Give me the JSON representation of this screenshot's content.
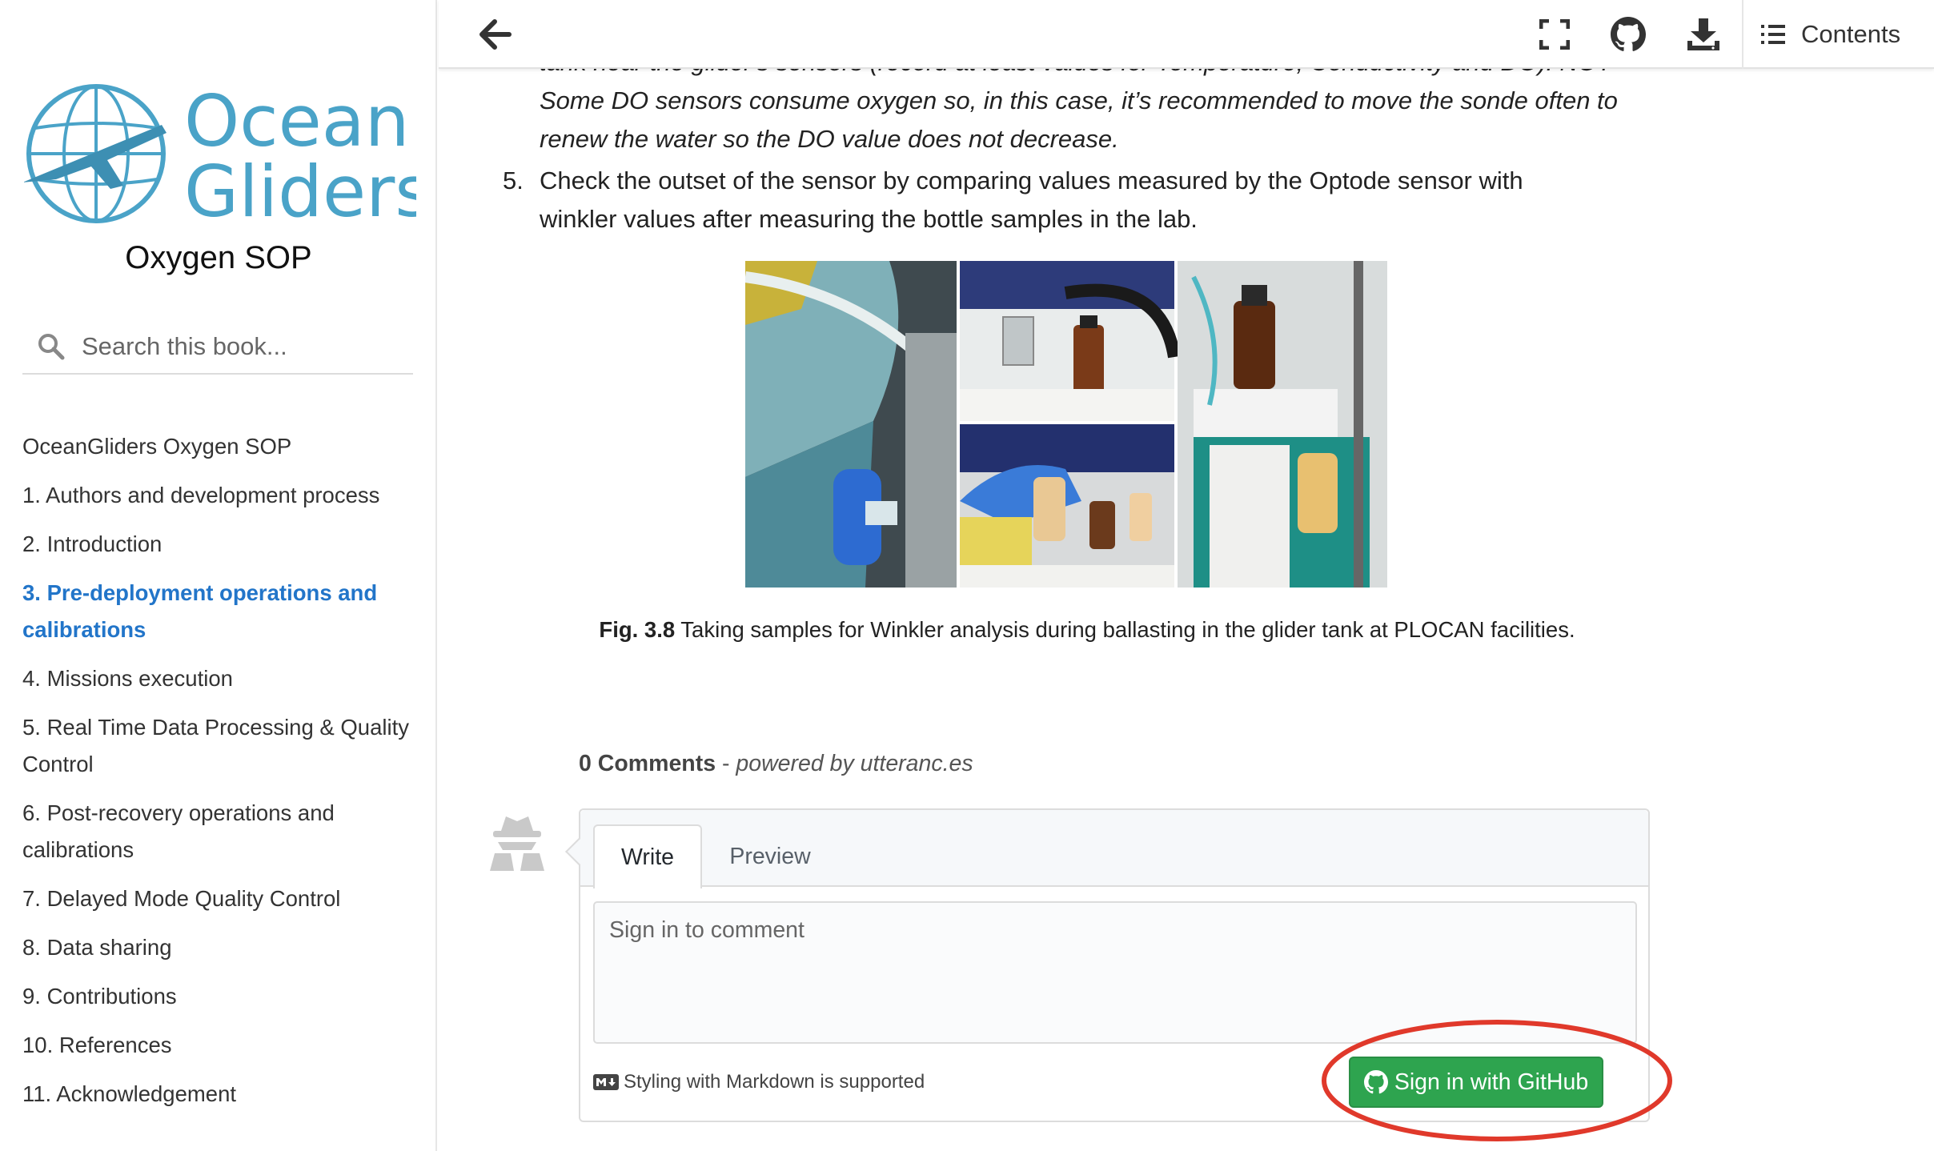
{
  "sidebar": {
    "logo_word1": "Ocean",
    "logo_word2": "Gliders",
    "book_title": "Oxygen SOP",
    "search_placeholder": "Search this book...",
    "toc": [
      {
        "label": "OceanGliders Oxygen SOP",
        "active": false
      },
      {
        "label": "1. Authors and development process",
        "active": false
      },
      {
        "label": "2. Introduction",
        "active": false
      },
      {
        "label": "3. Pre-deployment operations and calibrations",
        "active": true
      },
      {
        "label": "4. Missions execution",
        "active": false
      },
      {
        "label": "5. Real Time Data Processing & Quality Control",
        "active": false
      },
      {
        "label": "6. Post-recovery operations and calibrations",
        "active": false
      },
      {
        "label": "7. Delayed Mode Quality Control",
        "active": false
      },
      {
        "label": "8. Data sharing",
        "active": false
      },
      {
        "label": "9. Contributions",
        "active": false
      },
      {
        "label": "10. References",
        "active": false
      },
      {
        "label": "11. Acknowledgement",
        "active": false
      }
    ]
  },
  "topbar": {
    "back_icon": "arrow-left-icon",
    "fullscreen_icon": "fullscreen-icon",
    "github_icon": "github-icon",
    "download_icon": "download-icon",
    "contents_label": "Contents"
  },
  "article": {
    "cut_line": "tank near the glider's sensors (record at least values for Temperature, Conductivity and DO). NOTE:",
    "note_line1": "Some DO sensors consume oxygen so, in this case, it’s recommended to move the sonde often to",
    "note_line2": "renew the water so the DO value does not decrease.",
    "item5_number": "5.",
    "item5_text": "Check the outset of the sensor by comparing values measured by the Optode sensor with winkler values after measuring the bottle samples in the lab.",
    "figure_label": "Fig. 3.8",
    "figure_caption": " Taking samples for Winkler analysis during ballasting in the glider tank at PLOCAN facilities."
  },
  "comments": {
    "count_label": "0 Comments",
    "separator": " - ",
    "powered_by": "powered by utteranc.es",
    "tab_write": "Write",
    "tab_preview": "Preview",
    "placeholder": "Sign in to comment",
    "markdown_note": "Styling with Markdown is supported",
    "signin_label": "Sign in with GitHub"
  },
  "colors": {
    "accent_blue": "#2275c9",
    "logo_blue": "#4aa3c8",
    "signin_green": "#2ea44f",
    "highlight_red": "#e0392b"
  }
}
